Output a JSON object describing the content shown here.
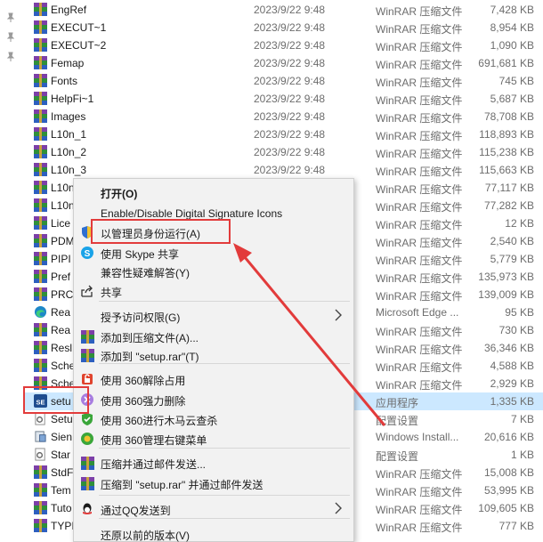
{
  "files": [
    {
      "name": "EngRef",
      "date": "2023/9/22 9:48",
      "type": "WinRAR 压缩文件",
      "size": "7,428 KB",
      "icon": "winrar-icon"
    },
    {
      "name": "EXECUT~1",
      "date": "2023/9/22 9:48",
      "type": "WinRAR 压缩文件",
      "size": "8,954 KB",
      "icon": "winrar-icon"
    },
    {
      "name": "EXECUT~2",
      "date": "2023/9/22 9:48",
      "type": "WinRAR 压缩文件",
      "size": "1,090 KB",
      "icon": "winrar-icon"
    },
    {
      "name": "Femap",
      "date": "2023/9/22 9:48",
      "type": "WinRAR 压缩文件",
      "size": "691,681 KB",
      "icon": "winrar-icon"
    },
    {
      "name": "Fonts",
      "date": "2023/9/22 9:48",
      "type": "WinRAR 压缩文件",
      "size": "745 KB",
      "icon": "winrar-icon"
    },
    {
      "name": "HelpFi~1",
      "date": "2023/9/22 9:48",
      "type": "WinRAR 压缩文件",
      "size": "5,687 KB",
      "icon": "winrar-icon"
    },
    {
      "name": "Images",
      "date": "2023/9/22 9:48",
      "type": "WinRAR 压缩文件",
      "size": "78,708 KB",
      "icon": "winrar-icon"
    },
    {
      "name": "L10n_1",
      "date": "2023/9/22 9:48",
      "type": "WinRAR 压缩文件",
      "size": "118,893 KB",
      "icon": "winrar-icon"
    },
    {
      "name": "L10n_2",
      "date": "2023/9/22 9:48",
      "type": "WinRAR 压缩文件",
      "size": "115,238 KB",
      "icon": "winrar-icon"
    },
    {
      "name": "L10n_3",
      "date": "2023/9/22 9:48",
      "type": "WinRAR 压缩文件",
      "size": "115,663 KB",
      "icon": "winrar-icon"
    },
    {
      "name": "L10n",
      "date": "",
      "type": "WinRAR 压缩文件",
      "size": "77,117 KB",
      "icon": "winrar-icon"
    },
    {
      "name": "L10n",
      "date": "",
      "type": "WinRAR 压缩文件",
      "size": "77,282 KB",
      "icon": "winrar-icon"
    },
    {
      "name": "Lice",
      "date": "",
      "type": "WinRAR 压缩文件",
      "size": "12 KB",
      "icon": "winrar-icon"
    },
    {
      "name": "PDM",
      "date": "",
      "type": "WinRAR 压缩文件",
      "size": "2,540 KB",
      "icon": "winrar-icon"
    },
    {
      "name": "PIPI",
      "date": "",
      "type": "WinRAR 压缩文件",
      "size": "5,779 KB",
      "icon": "winrar-icon"
    },
    {
      "name": "Pref",
      "date": "",
      "type": "WinRAR 压缩文件",
      "size": "135,973 KB",
      "icon": "winrar-icon"
    },
    {
      "name": "PRC",
      "date": "",
      "type": "WinRAR 压缩文件",
      "size": "139,009 KB",
      "icon": "winrar-icon"
    },
    {
      "name": "Rea",
      "date": "",
      "type": "Microsoft Edge ...",
      "size": "95 KB",
      "icon": "edge-icon"
    },
    {
      "name": "Rea",
      "date": "",
      "type": "WinRAR 压缩文件",
      "size": "730 KB",
      "icon": "winrar-icon"
    },
    {
      "name": "Resl",
      "date": "",
      "type": "WinRAR 压缩文件",
      "size": "36,346 KB",
      "icon": "winrar-icon"
    },
    {
      "name": "Sche",
      "date": "",
      "type": "WinRAR 压缩文件",
      "size": "4,588 KB",
      "icon": "winrar-icon"
    },
    {
      "name": "Sche",
      "date": "",
      "type": "WinRAR 压缩文件",
      "size": "2,929 KB",
      "icon": "winrar-icon"
    },
    {
      "name": "setu",
      "date": "",
      "type": "应用程序",
      "size": "1,335 KB",
      "icon": "setup-exe-icon",
      "selected": true
    },
    {
      "name": "Setu",
      "date": "",
      "type": "配置设置",
      "size": "7 KB",
      "icon": "config-file-icon"
    },
    {
      "name": "Sien",
      "date": "",
      "type": "Windows Install...",
      "size": "20,616 KB",
      "icon": "msi-icon"
    },
    {
      "name": "Star",
      "date": "",
      "type": "配置设置",
      "size": "1 KB",
      "icon": "config-file-icon"
    },
    {
      "name": "StdF",
      "date": "",
      "type": "WinRAR 压缩文件",
      "size": "15,008 KB",
      "icon": "winrar-icon"
    },
    {
      "name": "Tem",
      "date": "",
      "type": "WinRAR 压缩文件",
      "size": "53,995 KB",
      "icon": "winrar-icon"
    },
    {
      "name": "Tuto",
      "date": "",
      "type": "WinRAR 压缩文件",
      "size": "109,605 KB",
      "icon": "winrar-icon"
    },
    {
      "name": "TYPI",
      "date": "",
      "type": "WinRAR 压缩文件",
      "size": "777 KB",
      "icon": "winrar-icon"
    }
  ],
  "context_menu": {
    "items": [
      {
        "label": "打开(O)",
        "bold": true,
        "icon": ""
      },
      {
        "label": "Enable/Disable Digital Signature Icons",
        "icon": ""
      },
      {
        "label": "以管理员身份运行(A)",
        "icon": "uac-shield-icon"
      },
      {
        "label": "使用 Skype 共享",
        "icon": "skype-icon"
      },
      {
        "label": "兼容性疑难解答(Y)",
        "icon": ""
      },
      {
        "label": "共享",
        "icon": "share-icon"
      },
      {
        "label": "授予访问权限(G)",
        "icon": "",
        "submenu": true
      },
      {
        "label": "添加到压缩文件(A)...",
        "icon": "winrar-icon"
      },
      {
        "label": "添加到 \"setup.rar\"(T)",
        "icon": "winrar-icon"
      },
      {
        "label": "使用 360解除占用",
        "icon": "360-unlock-icon"
      },
      {
        "label": "使用 360强力删除",
        "icon": "360-delete-icon"
      },
      {
        "label": "使用 360进行木马云查杀",
        "icon": "360-scan-icon"
      },
      {
        "label": "使用 360管理右键菜单",
        "icon": "360-manage-icon"
      },
      {
        "label": "压缩并通过邮件发送...",
        "icon": "winrar-icon"
      },
      {
        "label": "压缩到 \"setup.rar\" 并通过邮件发送",
        "icon": "winrar-icon"
      },
      {
        "label": "通过QQ发送到",
        "icon": "qq-icon",
        "submenu": true
      },
      {
        "label": "还原以前的版本(V)",
        "icon": ""
      }
    ]
  },
  "colors": {
    "highlight": "#e23b3b",
    "selection": "#cce8ff"
  }
}
